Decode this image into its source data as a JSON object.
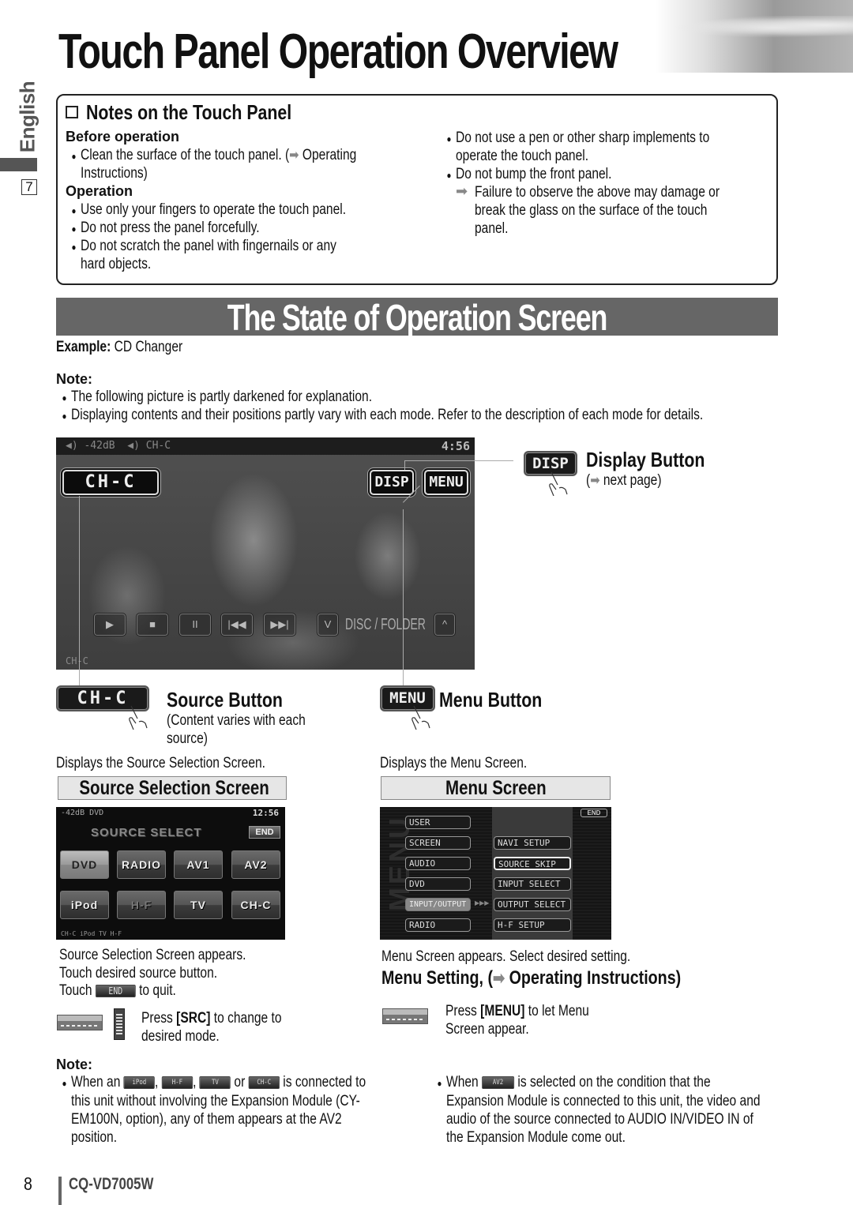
{
  "header": {
    "title": "Touch Panel Operation Overview",
    "side_tab": "English",
    "side_page_number": "7"
  },
  "notes": {
    "title": "Notes on the Touch Panel",
    "before_operation": {
      "heading": "Before operation",
      "items": [
        {
          "line1": "Clean the surface of the touch panel.  (",
          "ref": "Operating",
          "line2": "Instructions)"
        }
      ]
    },
    "operation": {
      "heading": "Operation",
      "items": [
        "Use only your fingers to operate the touch panel.",
        "Do not press the panel forcefully.",
        "Do not scratch the panel with fingernails or any",
        "hard objects."
      ]
    },
    "right_items": [
      "Do not use a pen or other sharp implements to",
      "operate the touch panel.",
      "Do not bump the front panel.",
      "Failure to observe the above may damage or",
      "break the glass on the surface of the touch",
      "panel."
    ]
  },
  "section": {
    "title": "The State of Operation Screen",
    "example_label": "Example:",
    "example_value": "CD Changer",
    "note_label": "Note:",
    "notes": [
      "The following picture is partly darkened for explanation.",
      "Displaying contents and their positions partly vary with each mode. Refer to the description of each mode for details."
    ]
  },
  "main_screen": {
    "status_volume": "-42dB",
    "status_source": "CH-C",
    "time": "4:56",
    "source_button": "CH-C",
    "disp_button": "DISP",
    "menu_button": "MENU",
    "controls": [
      "▶",
      "■",
      "II",
      "|◀◀",
      "▶▶|"
    ],
    "folder_down": "V",
    "folder_label": "DISC / FOLDER",
    "folder_up": "^",
    "corner_label": "CH-C"
  },
  "callouts": {
    "display": {
      "button": "DISP",
      "title": "Display Button",
      "sub": "next page"
    },
    "source": {
      "button": "CH-C",
      "title": "Source Button",
      "sub1": "(Content varies with each",
      "sub2": "source)",
      "desc": "Displays the Source Selection Screen."
    },
    "menu": {
      "button": "MENU",
      "title": "Menu Button",
      "desc": "Displays the Menu Screen."
    }
  },
  "source_selection": {
    "header": "Source Selection Screen",
    "screen": {
      "status": "-42dB  DVD",
      "time": "12:56",
      "title": "SOURCE SELECT",
      "end": "END",
      "buttons": [
        {
          "label": "DVD",
          "state": "selected"
        },
        {
          "label": "RADIO",
          "state": "normal"
        },
        {
          "label": "AV1",
          "state": "normal"
        },
        {
          "label": "AV2",
          "state": "normal"
        },
        {
          "label": "iPod",
          "state": "normal"
        },
        {
          "label": "H-F",
          "state": "disabled"
        },
        {
          "label": "TV",
          "state": "normal"
        },
        {
          "label": "CH-C",
          "state": "normal"
        }
      ],
      "footer": "CH-C  iPod  TV  H-F"
    },
    "text1": "Source Selection Screen appears.",
    "text2": "Touch desired source button.",
    "text3_pre": "Touch",
    "text3_chip": "END",
    "text3_post": "to quit.",
    "press_pre": "Press ",
    "press_key": "[SRC]",
    "press_post": " to change to",
    "press_line2": "desired mode."
  },
  "menu_screen": {
    "header": "Menu Screen",
    "screen": {
      "end": "END",
      "vertical_label": "MENU",
      "left_items": [
        "USER",
        "SCREEN",
        "AUDIO",
        "DVD",
        "INPUT/OUTPUT",
        "RADIO"
      ],
      "selected_left": "INPUT/OUTPUT",
      "right_items": [
        "NAVI SETUP",
        "SOURCE SKIP",
        "INPUT SELECT",
        "OUTPUT SELECT",
        "H-F SETUP"
      ],
      "highlighted_right": "SOURCE SKIP"
    },
    "text1": "Menu Screen appears. Select desired setting.",
    "setting_pre": "Menu Setting, (",
    "setting_ref": "Operating Instructions)",
    "press_pre": "Press ",
    "press_key": "[MENU]",
    "press_post": " to let Menu",
    "press_line2": "Screen appear."
  },
  "bottom_note": {
    "label": "Note:",
    "left": {
      "pre": "When an",
      "chips": [
        "iPod",
        "H-F",
        "TV",
        "CH-C"
      ],
      "sep1": ",",
      "sep2": ",",
      "or": "or",
      "post": "is connected to",
      "line2": "this unit without involving the Expansion Module (CY-",
      "line3": "EM100N, option), any of them appears at the AV2",
      "line4": "position."
    },
    "right": {
      "pre": "When",
      "chip": "AV2",
      "post": "is selected on the condition that the",
      "line2": "Expansion Module is connected to this unit, the video and",
      "line3": "audio of the source connected to AUDIO IN/VIDEO IN of",
      "line4": "the Expansion Module come out."
    }
  },
  "footer": {
    "page_number": "8",
    "model": "CQ-VD7005W"
  }
}
